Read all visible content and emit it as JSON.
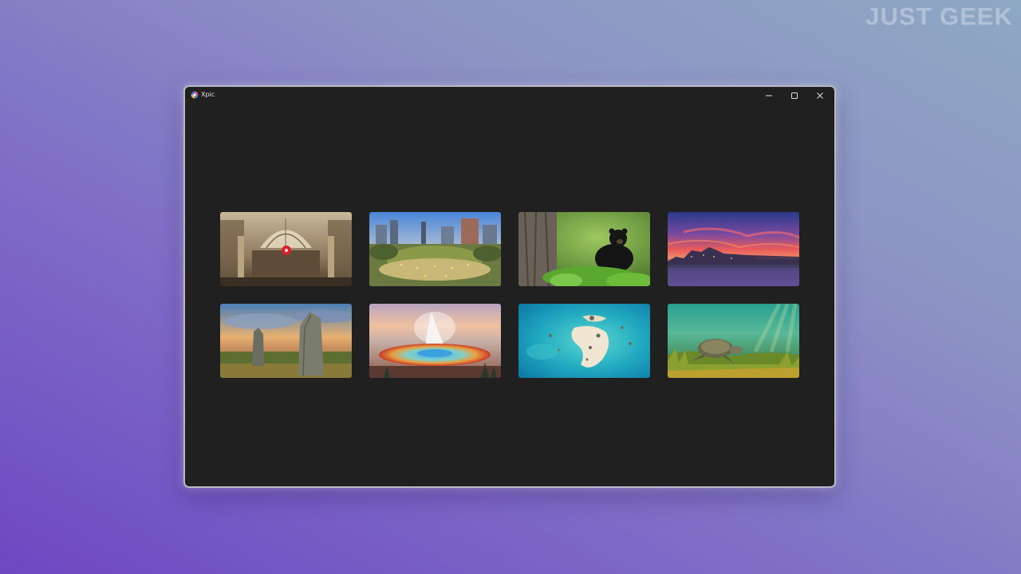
{
  "watermark": "JUST GEEK",
  "window": {
    "title": "Xpic",
    "app_icon": "xpic-app-icon",
    "controls": {
      "minimize": "minimize-icon",
      "maximize": "maximize-icon",
      "close": "close-icon"
    }
  },
  "gallery": {
    "wallpapers": [
      {
        "subject": "train-station-hall-thumbnail"
      },
      {
        "subject": "city-square-dusk-thumbnail"
      },
      {
        "subject": "black-bear-forest-thumbnail"
      },
      {
        "subject": "riverside-chateau-sunset-thumbnail"
      },
      {
        "subject": "standing-stones-thumbnail"
      },
      {
        "subject": "hot-spring-geyser-thumbnail"
      },
      {
        "subject": "tropical-sandbar-thumbnail"
      },
      {
        "subject": "sea-turtle-thumbnail"
      }
    ]
  }
}
